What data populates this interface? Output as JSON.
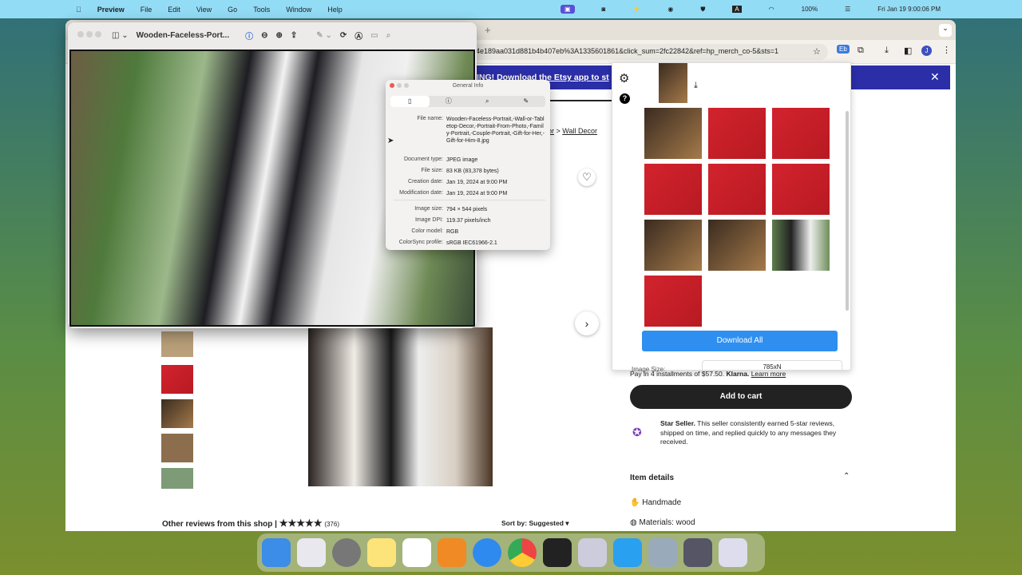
{
  "menubar": {
    "app": "Preview",
    "items": [
      "File",
      "Edit",
      "View",
      "Go",
      "Tools",
      "Window",
      "Help"
    ],
    "battery": "100%",
    "clock": "Fri Jan 19  9:00:06 PM"
  },
  "browser": {
    "url": "4e189aa031d881b4b407eb%3A1335601861&click_sum=2fc22842&ref=hp_merch_co-5&sts=1",
    "profile_initial": "J",
    "new_tab": "+"
  },
  "etsy": {
    "banner": "ING! Download the Etsy app to st",
    "breadcrumb_partial": "or",
    "breadcrumb": "Wall Decor",
    "installments": "Pay in 4 installments of $57.50.",
    "klarna": "Klarna.",
    "learn_more": "Learn more",
    "add_to_cart": "Add to cart",
    "star_seller_bold": "Star Seller.",
    "star_seller_text": "This seller consistently earned 5-star reviews, shipped on time, and replied quickly to any messages they received.",
    "item_details": "Item details",
    "details": [
      "Handmade",
      "Materials: wood"
    ],
    "reviews_label": "Other reviews from this shop",
    "review_count": "(376)",
    "sort": "Sort by: Suggested"
  },
  "preview": {
    "title": "Wooden-Faceless-Port..."
  },
  "info": {
    "title": "General Info",
    "rows": [
      {
        "k": "File name:",
        "v": "Wooden-Faceless-Portrait,-Wall-or-Tabletop-Decor,-Portrait-From-Photo,-Family-Portrait,-Couple-Portrait,-Gift-for-Her,-Gift-for-Him-8.jpg"
      },
      {
        "k": "Document type:",
        "v": "JPEG image"
      },
      {
        "k": "File size:",
        "v": "83 KB (83,378 bytes)"
      },
      {
        "k": "Creation date:",
        "v": "Jan 19, 2024 at 9:00 PM"
      },
      {
        "k": "Modification date:",
        "v": "Jan 19, 2024 at 9:00 PM"
      },
      {
        "k": "Image size:",
        "v": "794 × 544 pixels"
      },
      {
        "k": "Image DPI:",
        "v": "119.37 pixels/inch"
      },
      {
        "k": "Color model:",
        "v": "RGB"
      },
      {
        "k": "ColorSync profile:",
        "v": "sRGB IEC61966-2.1"
      }
    ]
  },
  "extension": {
    "download_all": "Download All",
    "image_size_label": "Image Size:",
    "image_size_value": "785xN"
  }
}
